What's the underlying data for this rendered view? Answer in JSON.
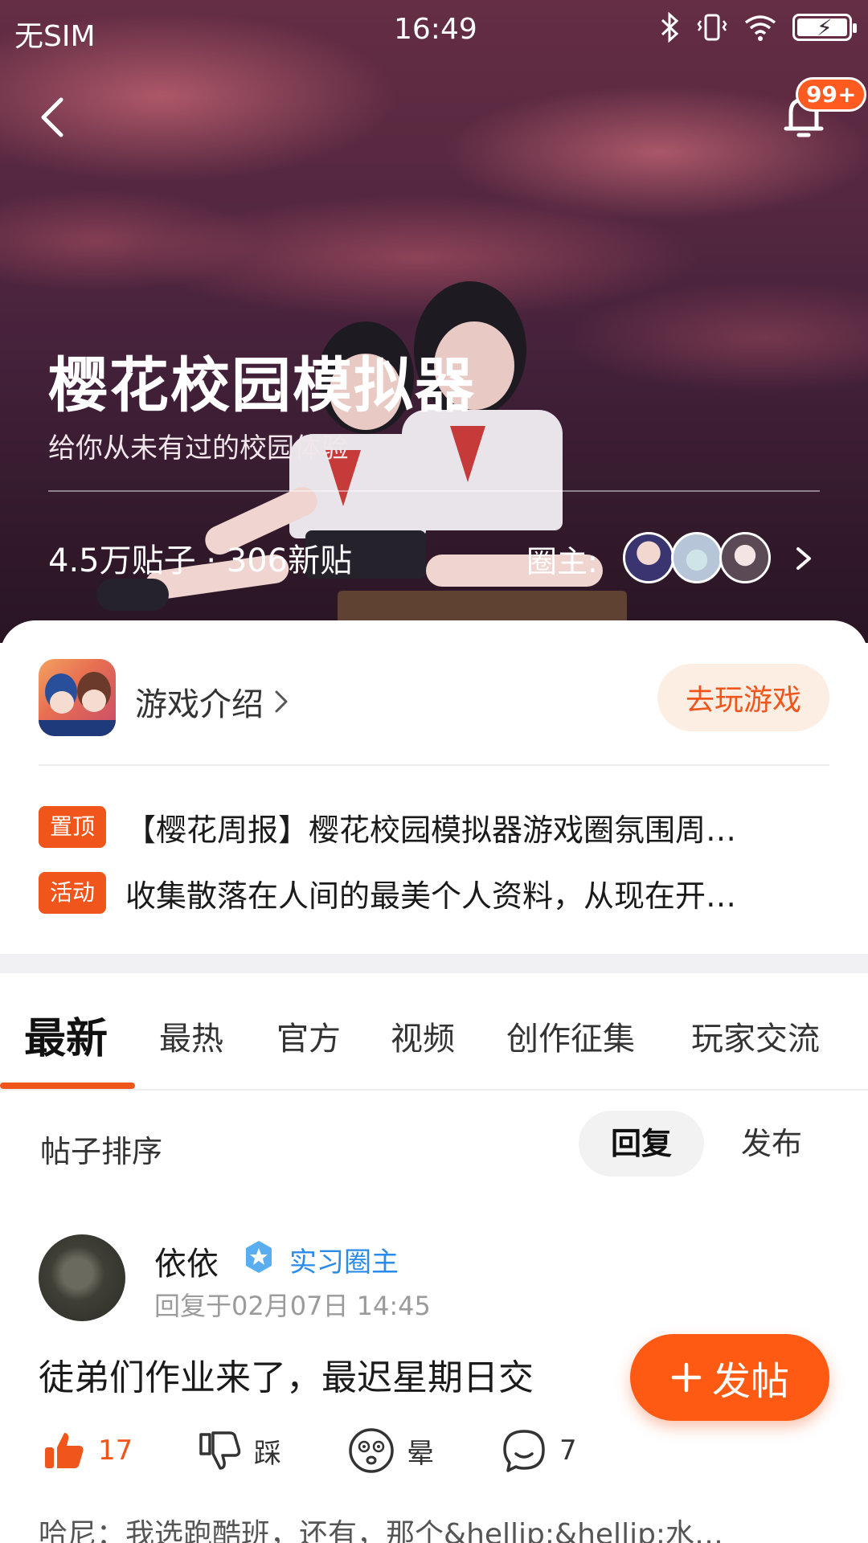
{
  "status_bar": {
    "carrier": "无SIM",
    "time": "16:49",
    "icons": [
      "bluetooth-icon",
      "vibrate-icon",
      "wifi-icon",
      "battery-charging-icon"
    ]
  },
  "header": {
    "back_icon": "chevron-left-icon",
    "bell_icon": "bell-icon",
    "notification_badge": "99+"
  },
  "circle": {
    "title": "樱花校园模拟器",
    "subtitle": "给你从未有过的校园体验",
    "stats": "4.5万贴子 · 306新贴",
    "owner_label": "圈主:"
  },
  "game": {
    "intro_label": "游戏介绍",
    "play_button": "去玩游戏"
  },
  "pinned": [
    {
      "tag": "置顶",
      "text": "【樱花周报】樱花校园模拟器游戏圈氛围周…"
    },
    {
      "tag": "活动",
      "text": "收集散落在人间的最美个人资料，从现在开…"
    }
  ],
  "tabs": [
    "最新",
    "最热",
    "官方",
    "视频",
    "创作征集",
    "玩家交流"
  ],
  "active_tab": "最新",
  "sort": {
    "label": "帖子排序",
    "options": [
      "回复",
      "发布"
    ],
    "selected": "回复"
  },
  "post": {
    "author": "依依",
    "role": "实习圈主",
    "time": "回复于02月07日 14:45",
    "body": "徒弟们作业来了，最迟星期日交",
    "likes": "17",
    "dislike_label": "踩",
    "dizzy_label": "晕",
    "comments": "7",
    "reply_preview": "哈尼：我选跑酷班，还有，那个&hellip;&hellip;水…"
  },
  "fab": {
    "label": "发帖"
  },
  "colors": {
    "accent": "#f0561c",
    "role_blue": "#2a8be8",
    "badge": "#ff5a1f"
  }
}
